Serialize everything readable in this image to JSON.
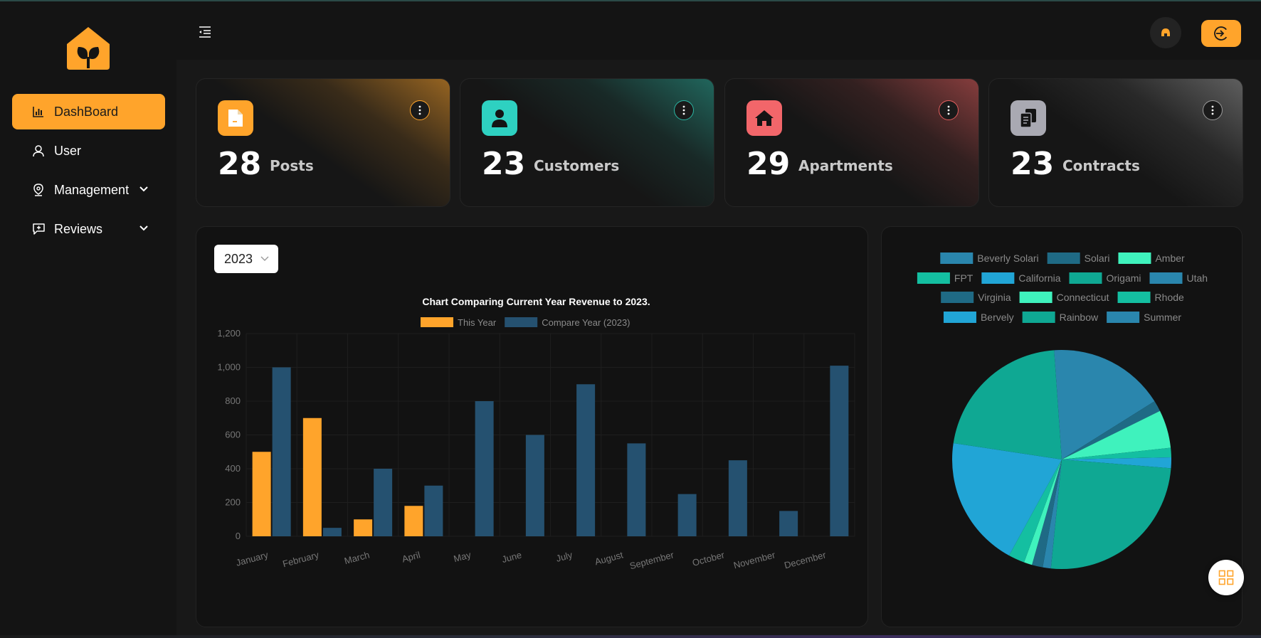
{
  "sidebar": {
    "items": [
      {
        "label": "DashBoard",
        "icon": "chart-bar-icon",
        "active": true
      },
      {
        "label": "User",
        "icon": "user-icon"
      },
      {
        "label": "Management",
        "icon": "location-pin-icon",
        "expandable": true
      },
      {
        "label": "Reviews",
        "icon": "comment-plus-icon",
        "expandable": true
      }
    ]
  },
  "stats": [
    {
      "count": "28",
      "label": "Posts",
      "icon": "document-icon",
      "color": "#ffa42b",
      "glow": "#ffa42b"
    },
    {
      "count": "23",
      "label": "Customers",
      "icon": "person-icon",
      "color": "#2ed1c1",
      "glow": "#2bb6a3"
    },
    {
      "count": "29",
      "label": "Apartments",
      "icon": "house-icon",
      "color": "#f2666a",
      "glow": "#e25d5d"
    },
    {
      "count": "23",
      "label": "Contracts",
      "icon": "clipboard-icon",
      "color": "#a9a9b2",
      "glow": "#9a9a9a"
    }
  ],
  "year_select": {
    "value": "2023"
  },
  "colors": {
    "accent": "#ffa42b",
    "compare": "#255170"
  },
  "chart_data": [
    {
      "type": "bar",
      "title": "Chart Comparing Current Year Revenue to 2023.",
      "categories": [
        "January",
        "February",
        "March",
        "April",
        "May",
        "June",
        "July",
        "August",
        "September",
        "October",
        "November",
        "December"
      ],
      "series": [
        {
          "name": "This Year",
          "color": "#ffa42b",
          "values": [
            500,
            700,
            100,
            180,
            0,
            0,
            0,
            0,
            0,
            0,
            0,
            0
          ]
        },
        {
          "name": "Compare Year (2023)",
          "color": "#255170",
          "values": [
            1000,
            50,
            400,
            300,
            800,
            600,
            900,
            550,
            250,
            450,
            150,
            1010
          ]
        }
      ],
      "ylim": [
        0,
        1200
      ],
      "yticks": [
        "0",
        "200",
        "400",
        "600",
        "800",
        "1,000",
        "1,200"
      ],
      "legend": "top",
      "grid": true
    },
    {
      "type": "pie",
      "legend": "top",
      "slices": [
        {
          "label": "Beverly Solari",
          "value": 17.2,
          "color": "#2a86ad"
        },
        {
          "label": "Solari",
          "value": 1.6,
          "color": "#1f6a85"
        },
        {
          "label": "Amber",
          "value": 5.6,
          "color": "#3ff2bd"
        },
        {
          "label": "FPT",
          "value": 1.4,
          "color": "#14bfa1"
        },
        {
          "label": "California",
          "value": 1.6,
          "color": "#21a5d6"
        },
        {
          "label": "Origami",
          "value": 25.3,
          "color": "#0fa893"
        },
        {
          "label": "Utah",
          "value": 1.2,
          "color": "#2a86ad"
        },
        {
          "label": "Virginia",
          "value": 1.6,
          "color": "#1f6a85"
        },
        {
          "label": "Connecticut",
          "value": 1.2,
          "color": "#3ff2bd"
        },
        {
          "label": "Rhode",
          "value": 2.4,
          "color": "#14bfa1"
        },
        {
          "label": "Bervely",
          "value": 19.4,
          "color": "#21a5d6"
        },
        {
          "label": "Rainbow",
          "value": 21.5,
          "color": "#0fa893"
        },
        {
          "label": "Summer",
          "value": 0,
          "color": "#2a86ad"
        }
      ]
    }
  ]
}
